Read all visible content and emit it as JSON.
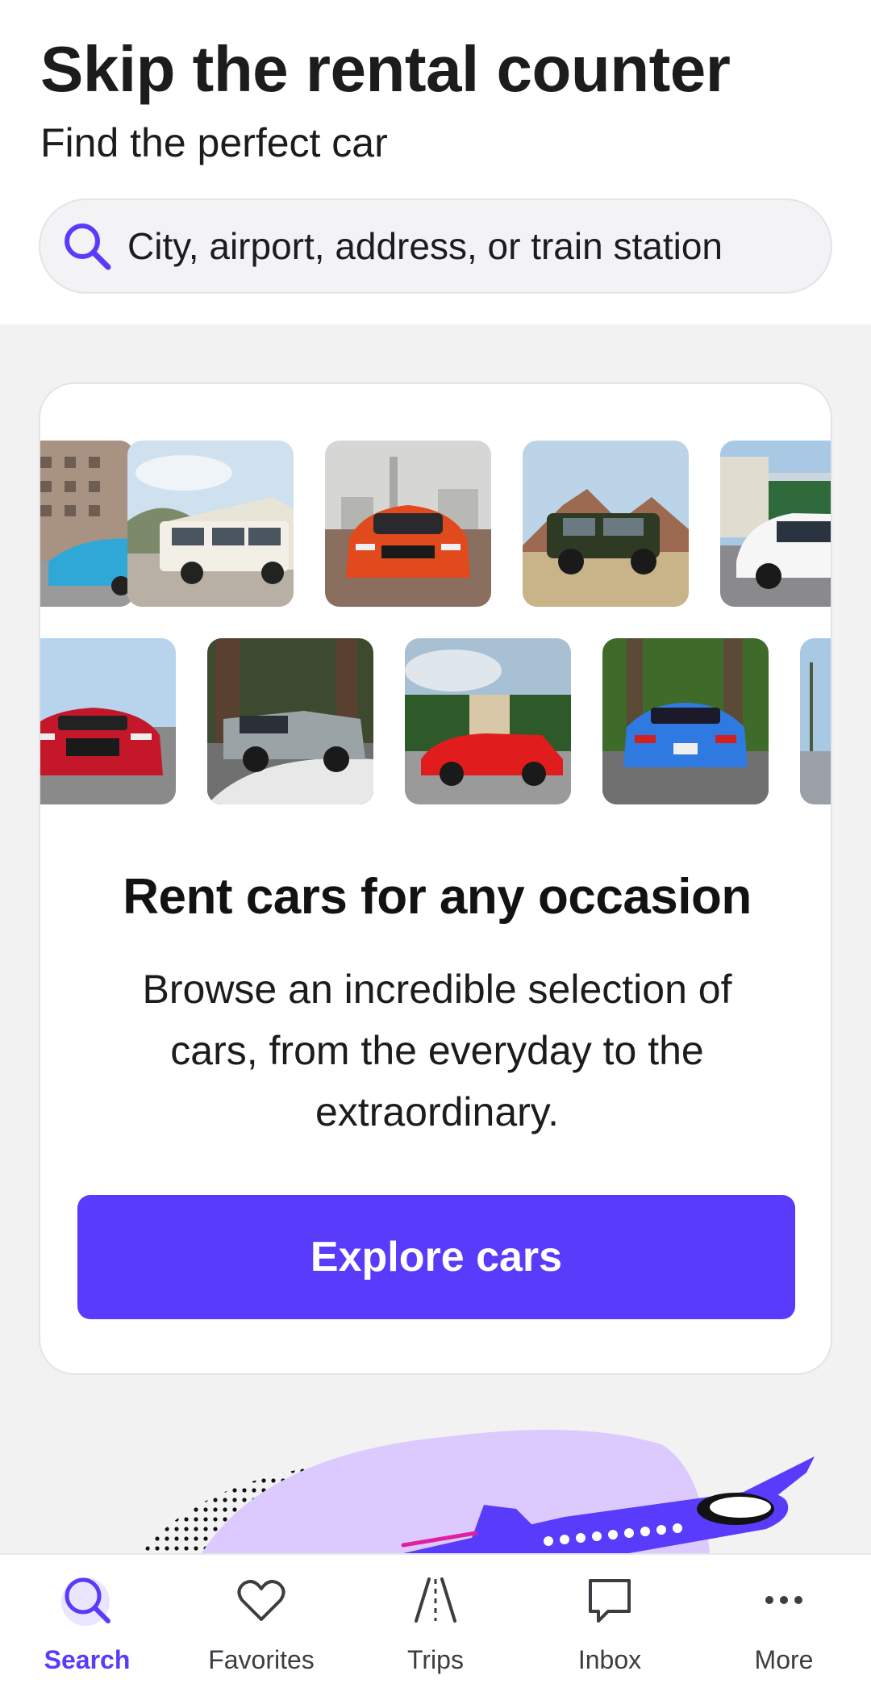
{
  "header": {
    "title": "Skip the rental counter",
    "subtitle": "Find the perfect car",
    "search_placeholder": "City, airport, address, or train station"
  },
  "card": {
    "heading": "Rent cars for any occasion",
    "body": "Browse an incredible selection of cars, from the everyday to the extraordinary.",
    "cta_label": "Explore cars"
  },
  "gallery": {
    "row1": [
      "blue-car",
      "camper-van",
      "orange-coupe",
      "green-suv",
      "white-hatchback"
    ],
    "row2": [
      "red-convertible",
      "electric-pickup",
      "red-roadster",
      "blue-muscle-car",
      "palm-beach-car"
    ]
  },
  "nav": {
    "items": [
      {
        "label": "Search",
        "icon": "search-icon",
        "active": true
      },
      {
        "label": "Favorites",
        "icon": "heart-icon",
        "active": false
      },
      {
        "label": "Trips",
        "icon": "road-icon",
        "active": false
      },
      {
        "label": "Inbox",
        "icon": "chat-bubble-icon",
        "active": false
      },
      {
        "label": "More",
        "icon": "more-dots-icon",
        "active": false
      }
    ]
  },
  "colors": {
    "accent": "#593cfb",
    "accent_light": "#ebe6ff",
    "promo_purple": "#dccaff",
    "background": "#f2f2f2"
  }
}
